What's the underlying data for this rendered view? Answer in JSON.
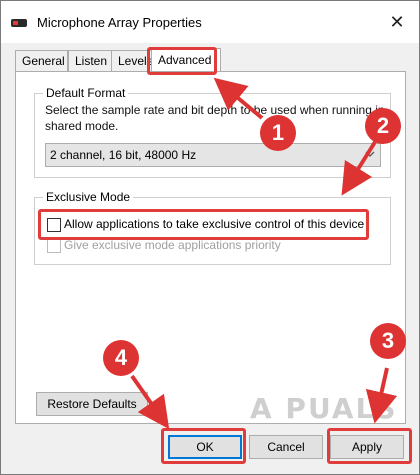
{
  "window": {
    "title": "Microphone Array Properties",
    "close_glyph": "✕",
    "app_icon": "microphone-icon"
  },
  "tabs": [
    {
      "label": "General",
      "active": false
    },
    {
      "label": "Listen",
      "active": false
    },
    {
      "label": "Levels",
      "active": false
    },
    {
      "label": "Advanced",
      "active": true
    }
  ],
  "default_format": {
    "group_label": "Default Format",
    "description": "Select the sample rate and bit depth to be used when running in shared mode.",
    "selected_value": "2 channel, 16 bit, 48000 Hz"
  },
  "exclusive_mode": {
    "group_label": "Exclusive Mode",
    "allow_exclusive_label": "Allow applications to take exclusive control of this device",
    "allow_exclusive_checked": false,
    "priority_label": "Give exclusive mode applications priority",
    "priority_checked": false,
    "priority_enabled": false
  },
  "buttons": {
    "restore_defaults": "Restore Defaults",
    "ok": "OK",
    "cancel": "Cancel",
    "apply": "Apply"
  },
  "annotations": {
    "badges": [
      "1",
      "2",
      "3",
      "4"
    ],
    "highlight_color": "#e03c3c"
  },
  "watermark": "A PUALS"
}
